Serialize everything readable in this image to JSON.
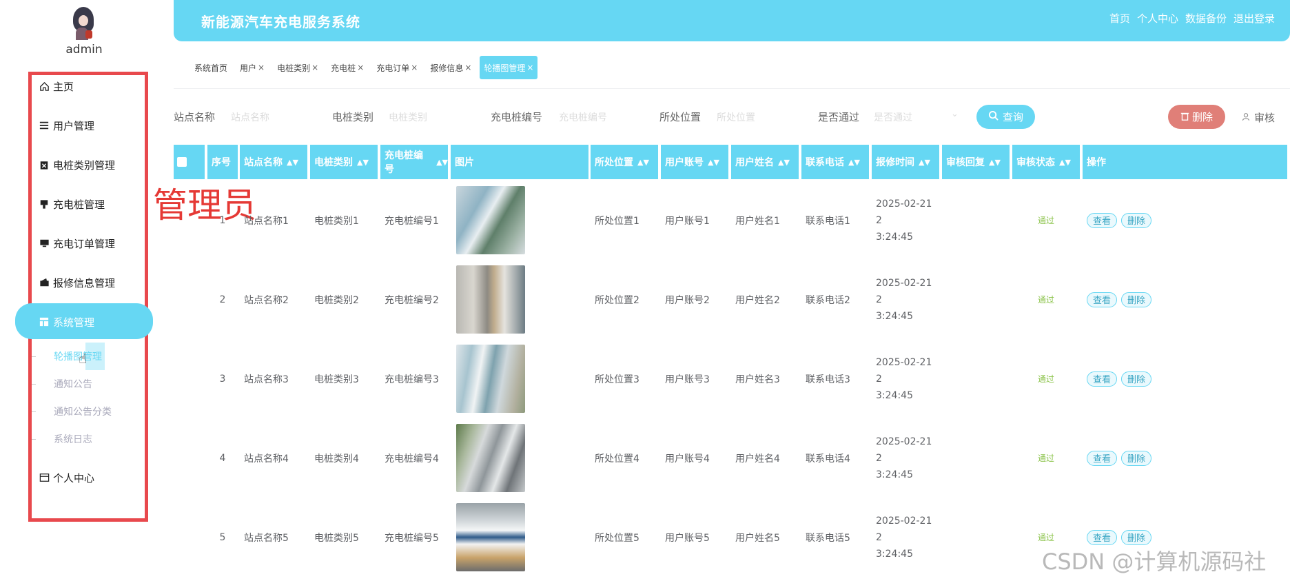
{
  "sidebar": {
    "username": "admin",
    "menu": [
      {
        "label": "主页",
        "icon": "home-icon"
      },
      {
        "label": "用户管理",
        "icon": "list-icon"
      },
      {
        "label": "电桩类别管理",
        "icon": "clipboard-icon"
      },
      {
        "label": "充电桩管理",
        "icon": "charger-icon"
      },
      {
        "label": "充电订单管理",
        "icon": "monitor-icon"
      },
      {
        "label": "报修信息管理",
        "icon": "wallet-icon"
      },
      {
        "label": "系统管理",
        "icon": "grid-icon",
        "active": true
      },
      {
        "label": "个人中心",
        "icon": "card-icon"
      }
    ],
    "submenu": [
      "轮播图管理",
      "通知公告",
      "通知公告分类",
      "系统日志"
    ]
  },
  "annotation": "管理员",
  "header": {
    "title": "新能源汽车充电服务系统",
    "links": [
      "首页",
      "个人中心",
      "数据备份",
      "退出登录"
    ]
  },
  "tabs": [
    {
      "label": "系统首页",
      "closable": false
    },
    {
      "label": "用户",
      "closable": true
    },
    {
      "label": "电桩类别",
      "closable": true
    },
    {
      "label": "充电桩",
      "closable": true
    },
    {
      "label": "充电订单",
      "closable": true
    },
    {
      "label": "报修信息",
      "closable": true
    },
    {
      "label": "轮播图管理",
      "closable": true,
      "active": true
    }
  ],
  "search": {
    "fields": [
      {
        "label": "站点名称",
        "placeholder": "站点名称"
      },
      {
        "label": "电桩类别",
        "placeholder": "电桩类别"
      },
      {
        "label": "充电桩编号",
        "placeholder": "充电桩编号"
      },
      {
        "label": "所处位置",
        "placeholder": "所处位置"
      },
      {
        "label": "是否通过",
        "placeholder": "是否通过"
      }
    ],
    "query_label": "查询",
    "delete_label": "删除",
    "audit_label": "审核"
  },
  "table": {
    "headers": [
      "序号",
      "站点名称",
      "电桩类别",
      "充电桩编号",
      "图片",
      "所处位置",
      "用户账号",
      "用户姓名",
      "联系电话",
      "报修时间",
      "审核回复",
      "审核状态",
      "操作"
    ],
    "view_label": "查看",
    "delete_label": "删除",
    "rows": [
      {
        "no": "1",
        "site": "站点名称1",
        "type": "电桩类别1",
        "code": "充电桩编号1",
        "location": "所处位置1",
        "account": "用户账号1",
        "name": "用户姓名1",
        "phone": "联系电话1",
        "time1": "2025-02-21 2",
        "time2": "3:24:45",
        "reply": "",
        "status": "通过"
      },
      {
        "no": "2",
        "site": "站点名称2",
        "type": "电桩类别2",
        "code": "充电桩编号2",
        "location": "所处位置2",
        "account": "用户账号2",
        "name": "用户姓名2",
        "phone": "联系电话2",
        "time1": "2025-02-21 2",
        "time2": "3:24:45",
        "reply": "",
        "status": "通过"
      },
      {
        "no": "3",
        "site": "站点名称3",
        "type": "电桩类别3",
        "code": "充电桩编号3",
        "location": "所处位置3",
        "account": "用户账号3",
        "name": "用户姓名3",
        "phone": "联系电话3",
        "time1": "2025-02-21 2",
        "time2": "3:24:45",
        "reply": "",
        "status": "通过"
      },
      {
        "no": "4",
        "site": "站点名称4",
        "type": "电桩类别4",
        "code": "充电桩编号4",
        "location": "所处位置4",
        "account": "用户账号4",
        "name": "用户姓名4",
        "phone": "联系电话4",
        "time1": "2025-02-21 2",
        "time2": "3:24:45",
        "reply": "",
        "status": "通过"
      },
      {
        "no": "5",
        "site": "站点名称5",
        "type": "电桩类别5",
        "code": "充电桩编号5",
        "location": "所处位置5",
        "account": "用户账号5",
        "name": "用户姓名5",
        "phone": "联系电话5",
        "time1": "2025-02-21 2",
        "time2": "3:24:45",
        "reply": "",
        "status": "通过"
      }
    ]
  },
  "watermark": "CSDN @计算机源码社",
  "colors": {
    "primary": "#66d7f3",
    "danger": "#e07f78",
    "frame": "#e8494d",
    "pass": "#8bc34a",
    "annotation": "#e53935"
  }
}
